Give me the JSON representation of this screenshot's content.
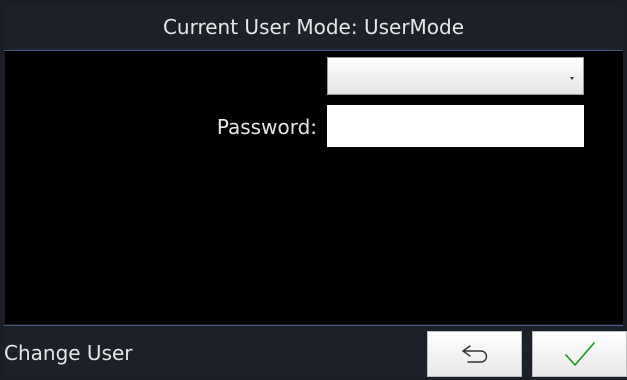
{
  "header": {
    "title": "Current User Mode: UserMode"
  },
  "form": {
    "user_select_value": "",
    "password_label": "Password:",
    "password_value": ""
  },
  "footer": {
    "label": "Change User"
  },
  "buttons": {
    "back_icon": "return-arrow-icon",
    "confirm_icon": "checkmark-icon",
    "confirm_color": "#1a9a1a"
  },
  "colors": {
    "header_bg": "#1c2029",
    "divider": "#4a5880",
    "content_bg": "#000000",
    "text": "#e6e6e6"
  }
}
